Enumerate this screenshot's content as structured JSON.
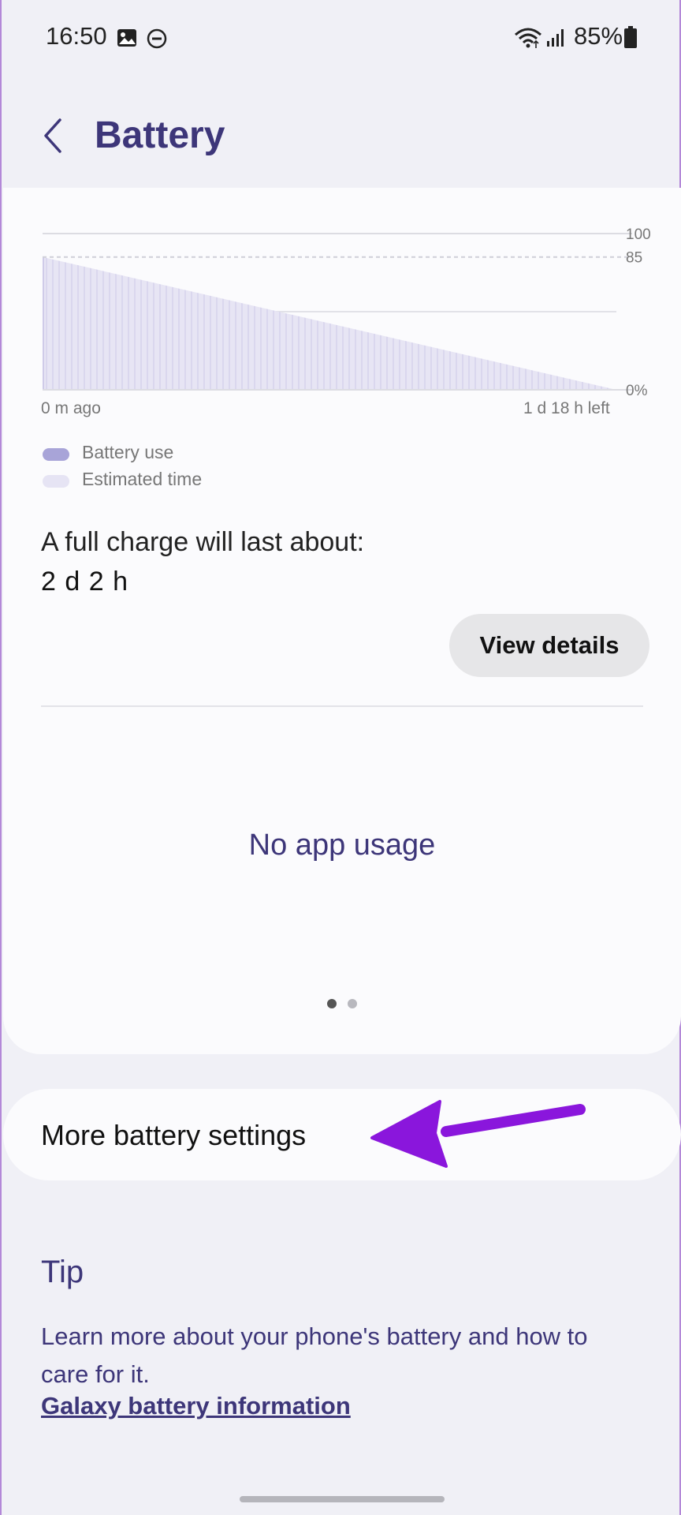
{
  "status_bar": {
    "time": "16:50",
    "battery_percent": "85%",
    "icons": [
      "image-icon",
      "dnd-icon",
      "wifi-icon",
      "signal-icon",
      "battery-icon"
    ]
  },
  "header": {
    "back_icon": "chevron-left-icon",
    "title": "Battery"
  },
  "chart": {
    "x_start_label": "0 m ago",
    "x_end_label": "1 d 18 h left",
    "legend": [
      {
        "label": "Battery use",
        "color": "#a8a4d8"
      },
      {
        "label": "Estimated time",
        "color": "#e6e4f4"
      }
    ]
  },
  "chart_data": {
    "type": "area",
    "x": [
      "0 m ago",
      "1 d 18 h left"
    ],
    "y_tick_labels": [
      "100",
      "85",
      "0%"
    ],
    "ylim": [
      0,
      100
    ],
    "series": [
      {
        "name": "Estimated time",
        "values": [
          85,
          0
        ]
      }
    ],
    "grid": true,
    "legend_position": "bottom-left"
  },
  "summary": {
    "label": "A full charge will last about:",
    "value": "2 d 2 h",
    "view_details": "View details"
  },
  "app_usage": {
    "empty_text": "No app usage",
    "page_count": 2,
    "current_page": 1
  },
  "more_settings": {
    "label": "More battery settings",
    "annotation_color": "#8a16dc"
  },
  "tip": {
    "title": "Tip",
    "text": "Learn more about your phone's battery and how to care for it.",
    "link": "Galaxy battery information"
  },
  "colors": {
    "accent": "#3d3679",
    "background": "#f0f0f6",
    "card": "#fbfbfd"
  }
}
